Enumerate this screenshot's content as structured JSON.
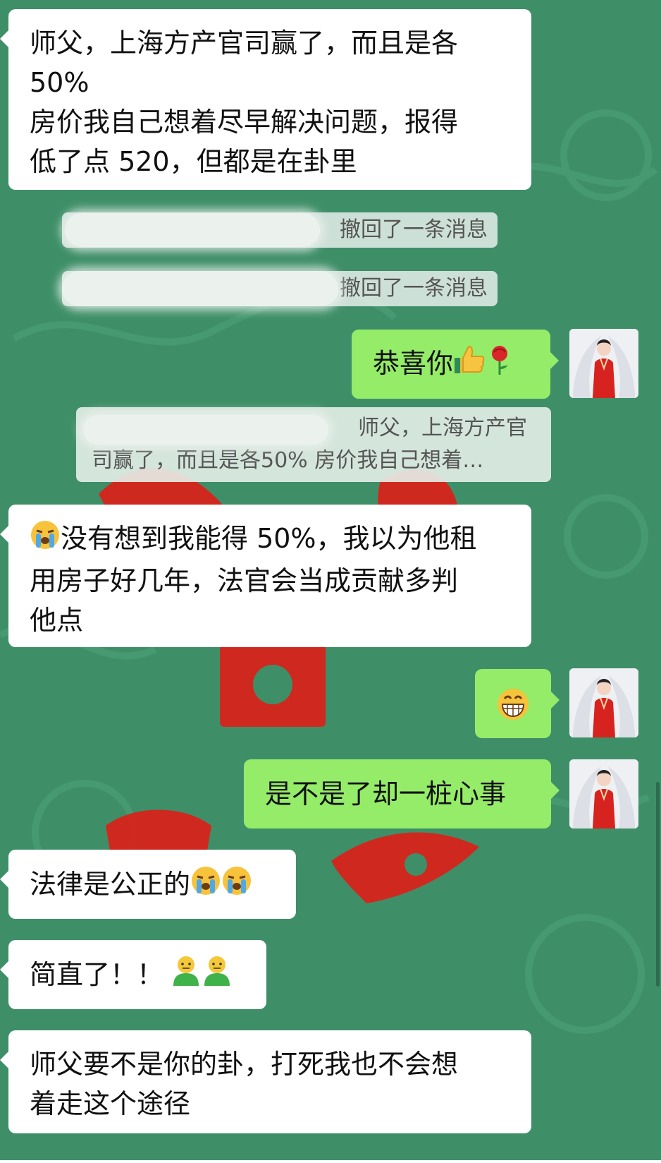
{
  "colors": {
    "chat_background": "#3e8f68",
    "incoming_bubble": "#ffffff",
    "outgoing_bubble": "#95ec69"
  },
  "messages": [
    {
      "side": "incoming",
      "lines": [
        "师父，上海方产官司赢了，而且是各",
        "50%",
        "房价我自己想着尽早解决问题，报得",
        "低了点 520，但都是在卦里"
      ]
    },
    {
      "side": "system",
      "text": "撤回了一条消息"
    },
    {
      "side": "system",
      "text": "撤回了一条消息"
    },
    {
      "side": "outgoing",
      "text": "恭喜你",
      "emojis": [
        "thumbs-up-icon",
        "rose-icon"
      ]
    },
    {
      "side": "quote",
      "lines": [
        "师父，上海方产官",
        "司赢了，而且是各50% 房价我自己想着…"
      ]
    },
    {
      "side": "incoming",
      "lines": [
        "没有想到我能得 50%，我以为他租",
        "用房子好几年，法官会当成贡献多判",
        "他点"
      ],
      "lead_emoji": "crying-face-icon"
    },
    {
      "side": "outgoing",
      "emoji": "grinning-face-icon"
    },
    {
      "side": "outgoing",
      "text": "是不是了却一桩心事"
    },
    {
      "side": "incoming",
      "text": "法律是公正的",
      "emojis": [
        "crying-face-icon",
        "crying-face-icon"
      ]
    },
    {
      "side": "incoming",
      "text": "简直了！！",
      "emojis": [
        "green-figure-icon",
        "green-figure-icon"
      ]
    },
    {
      "side": "incoming",
      "lines": [
        "师父要不是你的卦，打死我也不会想",
        "着走这个途径"
      ]
    }
  ]
}
